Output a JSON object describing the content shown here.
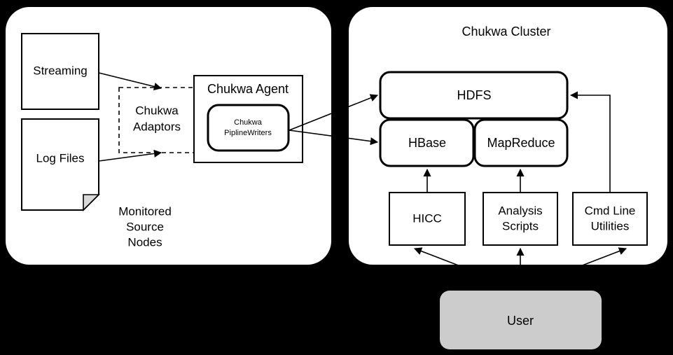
{
  "diagram": {
    "background_color": "#000000",
    "panel_color": "#ffffff",
    "user_box_color": "#cccccc",
    "left_panel": {
      "caption_line1": "Monitored",
      "caption_line2": "Source",
      "caption_line3": "Nodes",
      "nodes": {
        "streaming": "Streaming",
        "log_files": "Log Files",
        "adaptors_line1": "Chukwa",
        "adaptors_line2": "Adaptors",
        "agent": "Chukwa Agent",
        "pipeline_line1": "Chukwa",
        "pipeline_line2": "PiplineWriters"
      }
    },
    "right_panel": {
      "title": "Chukwa Cluster",
      "nodes": {
        "hdfs": "HDFS",
        "hbase": "HBase",
        "mapreduce": "MapReduce",
        "hicc": "HICC",
        "analysis_line1": "Analysis",
        "analysis_line2": "Scripts",
        "cmdline_line1": "Cmd Line",
        "cmdline_line2": "Utilities"
      }
    },
    "user": {
      "label": "User"
    }
  }
}
